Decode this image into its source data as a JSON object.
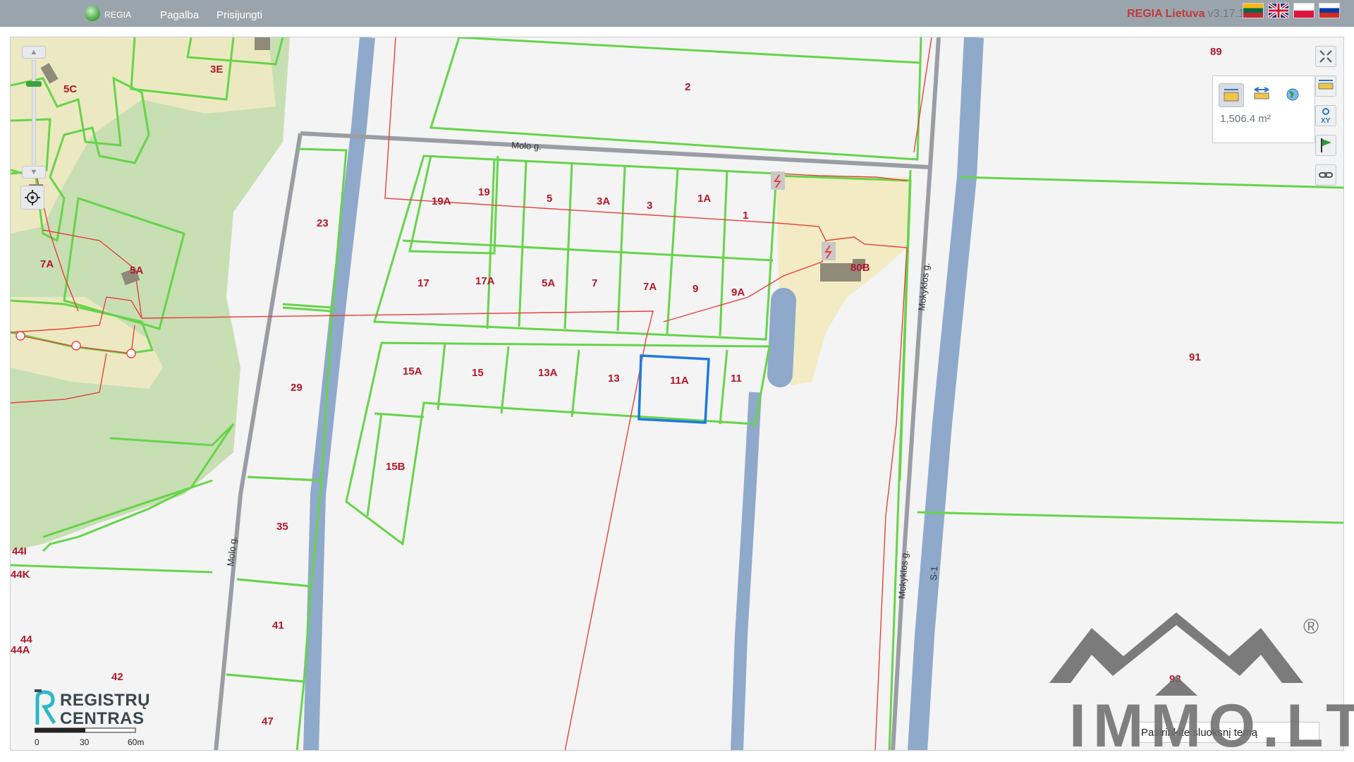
{
  "topbar": {
    "logo_text": "REGIA",
    "nav": [
      "Pagalba",
      "Prisijungti"
    ],
    "brand": "REGIA Lietuva",
    "version": "v3.17.1",
    "languages": [
      {
        "code": "lt",
        "icon": "lithuania-flag-icon"
      },
      {
        "code": "en",
        "icon": "uk-flag-icon"
      },
      {
        "code": "pl",
        "icon": "poland-flag-icon"
      },
      {
        "code": "ru",
        "icon": "russia-flag-icon"
      }
    ]
  },
  "map": {
    "parcels": [
      "89",
      "2",
      "3E",
      "5C",
      "7A",
      "5A",
      "23",
      "19A",
      "19",
      "5",
      "3A",
      "3",
      "1A",
      "1",
      "17",
      "17A",
      "5A",
      "7",
      "7A",
      "9",
      "9A",
      "80B",
      "15A",
      "15",
      "13A",
      "13",
      "11A",
      "11",
      "29",
      "15B",
      "35",
      "41",
      "47",
      "44I",
      "44K",
      "44",
      "44A",
      "42",
      "91",
      "93"
    ],
    "streets": [
      "Molo g.",
      "Molo g.",
      "Mokyklos g.",
      "Mokyklos g.",
      "S-1"
    ],
    "selected_parcel": "11A",
    "colors": {
      "parcel_line": "#66d44a",
      "road": "#8fa9cb",
      "utility": "#e8413a",
      "selection": "#1f78e0",
      "forest": "#c8dfb4",
      "built": "#f2ebc4"
    }
  },
  "controls": {
    "zoom_in": "▲",
    "zoom_out": "▼",
    "measure_value": "1,506.4 m²",
    "right_tools": [
      "collapse-icon",
      "measure-icon",
      "coordinates-icon",
      "flag-icon",
      "link-icon"
    ],
    "xy_label": "XY"
  },
  "watermark": {
    "org_line1": "REGISTRŲ",
    "org_line2": "CENTRAS",
    "scale_labels": [
      "0",
      "30",
      "60m"
    ],
    "immo_text": "IMMO.LT",
    "immo_mark": "®"
  },
  "layer_search": {
    "value": "Pasirinkite sluoksnį temą"
  }
}
